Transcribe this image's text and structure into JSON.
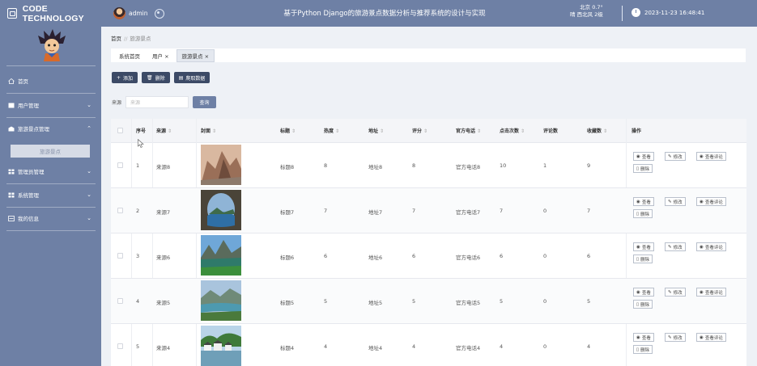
{
  "brand": {
    "title": "CODE TECHNOLOGY"
  },
  "header": {
    "username": "admin",
    "system_title": "基于Python Django的旅游景点数据分析与推荐系统的设计与实现",
    "weather_line1": "北京 0.7°",
    "weather_line2": "晴 西北风 2级",
    "datetime": "2023-11-23 16:48:41"
  },
  "sidebar": {
    "items": [
      {
        "label": "首页",
        "icon": "home-icon",
        "expanded": null
      },
      {
        "label": "用户管理",
        "icon": "user-icon",
        "expanded": false
      },
      {
        "label": "旅游景点管理",
        "icon": "building-icon",
        "expanded": true
      },
      {
        "label": "管理员管理",
        "icon": "grid-icon",
        "expanded": false
      },
      {
        "label": "系统管理",
        "icon": "grid-icon",
        "expanded": false
      },
      {
        "label": "我的信息",
        "icon": "id-card-icon",
        "expanded": false
      }
    ],
    "sub_item": "旅游景点"
  },
  "breadcrumb": {
    "home": "首页",
    "separator": "//",
    "current": "旅游景点"
  },
  "tabs": [
    {
      "label": "系统首页",
      "closable": false,
      "active": false
    },
    {
      "label": "用户",
      "closable": true,
      "active": false
    },
    {
      "label": "旅游景点",
      "closable": true,
      "active": true
    }
  ],
  "toolbar": {
    "add_label": "添加",
    "delete_label": "删除",
    "crawl_label": "爬取数据"
  },
  "search": {
    "label": "来源",
    "placeholder": "来源",
    "button_label": "查询"
  },
  "table": {
    "columns": [
      "序号",
      "来源",
      "封面",
      "标题",
      "热度",
      "地址",
      "评分",
      "官方电话",
      "点击次数",
      "评论数",
      "收藏数",
      "操作"
    ],
    "sortable": [
      false,
      true,
      true,
      true,
      true,
      true,
      true,
      true,
      true,
      false,
      true,
      false
    ],
    "rows": [
      {
        "index": "1",
        "source": "来源8",
        "title": "标题8",
        "heat": "8",
        "address": "地址8",
        "score": "8",
        "phone": "官方电话8",
        "clicks": "10",
        "comments": "1",
        "favorites": "9",
        "cover": "mountain-rock"
      },
      {
        "index": "2",
        "source": "来源7",
        "title": "标题7",
        "heat": "7",
        "address": "地址7",
        "score": "7",
        "phone": "官方电话7",
        "clicks": "7",
        "comments": "0",
        "favorites": "7",
        "cover": "cave-lake"
      },
      {
        "index": "3",
        "source": "来源6",
        "title": "标题6",
        "heat": "6",
        "address": "地址6",
        "score": "6",
        "phone": "官方电话6",
        "clicks": "6",
        "comments": "0",
        "favorites": "6",
        "cover": "alpine-lake"
      },
      {
        "index": "4",
        "source": "来源5",
        "title": "标题5",
        "heat": "5",
        "address": "地址5",
        "score": "5",
        "phone": "官方电话5",
        "clicks": "5",
        "comments": "0",
        "favorites": "5",
        "cover": "river-valley"
      },
      {
        "index": "5",
        "source": "来源4",
        "title": "标题4",
        "heat": "4",
        "address": "地址4",
        "score": "4",
        "phone": "官方电话4",
        "clicks": "4",
        "comments": "0",
        "favorites": "4",
        "cover": "water-village"
      }
    ],
    "row_actions": {
      "view": "查看",
      "edit": "修改",
      "view_comments": "查看评论",
      "delete": "删除"
    }
  },
  "colors": {
    "primary": "#6e80a5",
    "dark_button": "#3c4a66",
    "background": "#eef1f6"
  }
}
